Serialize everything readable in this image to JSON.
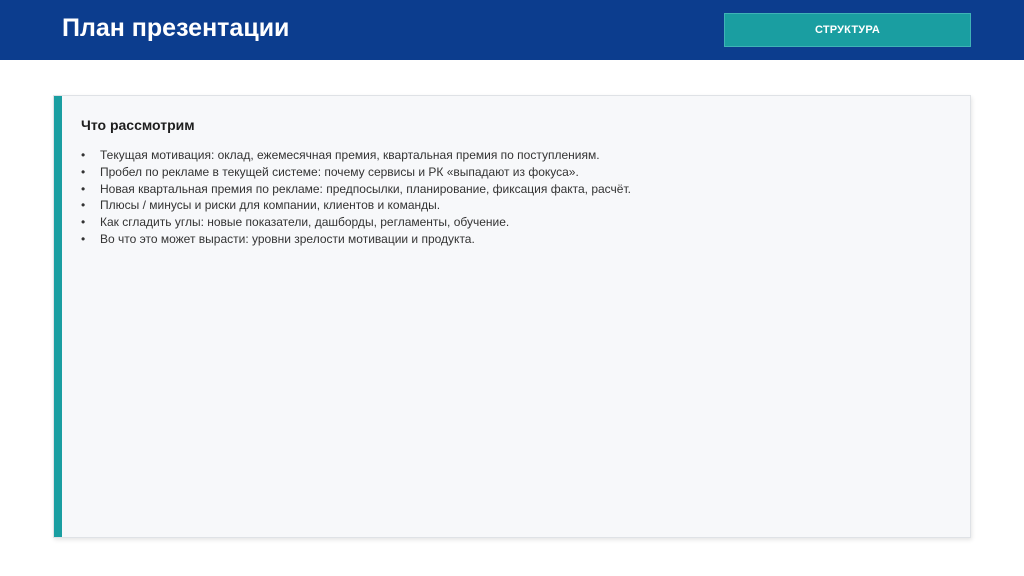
{
  "header": {
    "title": "План презентации",
    "section_badge": "СТРУКТУРА"
  },
  "card": {
    "heading": "Что рассмотрим",
    "bullet_symbol": "•",
    "items": [
      "Текущая мотивация: оклад, ежемесячная премия, квартальная премия по поступлениям.",
      "Пробел по рекламе в текущей системе: почему сервисы и РК «выпадают из фокуса».",
      "Новая квартальная премия по рекламе: предпосылки, планирование, фиксация факта, расчёт.",
      "Плюсы / минусы и риски для компании, клиентов и команды.",
      "Как сгладить углы: новые показатели, дашборды, регламенты, обучение.",
      "Во что это может вырасти: уровни зрелости мотивации и продукта."
    ]
  },
  "colors": {
    "header_band": "#0c3d8e",
    "accent": "#1a9ea1",
    "card_background": "#f7f8fa"
  }
}
